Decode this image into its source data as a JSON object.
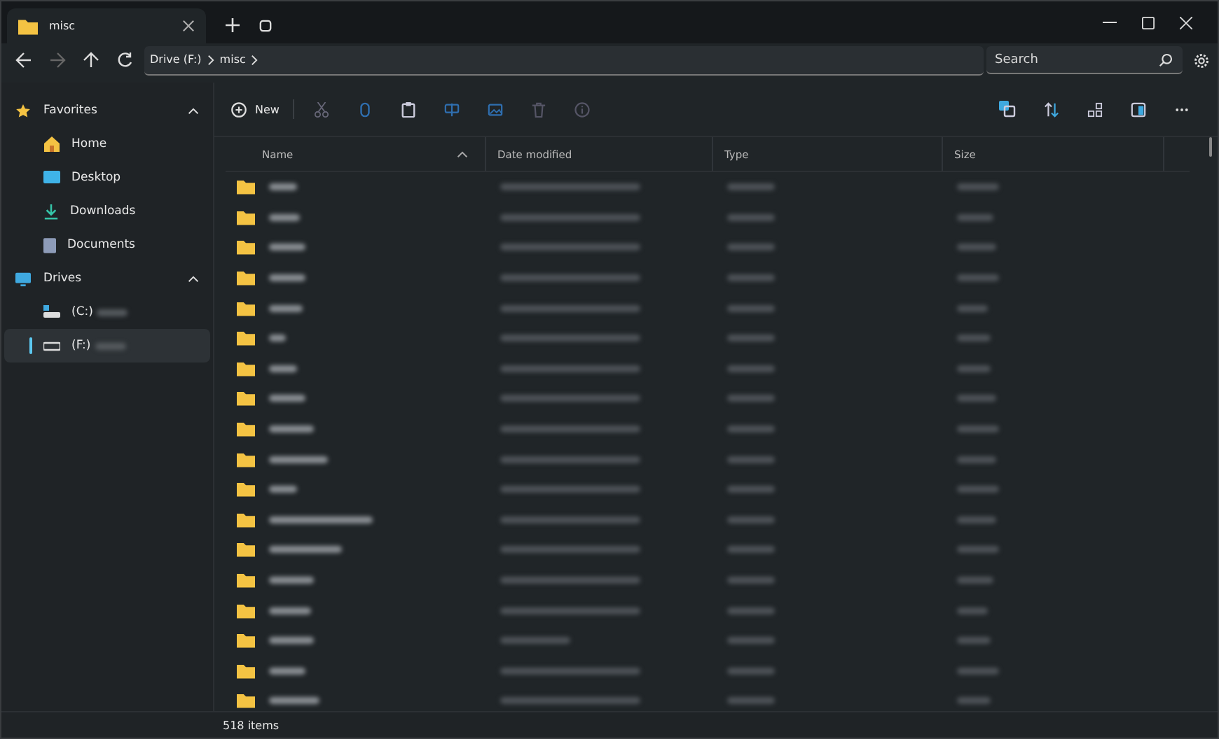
{
  "tab": {
    "title": "misc",
    "selected": true
  },
  "breadcrumb": [
    "Drive (F:)",
    "misc"
  ],
  "search": {
    "placeholder": "Search"
  },
  "sidebar": {
    "sections": [
      {
        "label": "Favorites",
        "kind": "favorites",
        "expanded": true,
        "items": [
          {
            "label": "Home",
            "kind": "home",
            "selected": false
          },
          {
            "label": "Desktop",
            "kind": "desktop",
            "selected": false
          },
          {
            "label": "Downloads",
            "kind": "downloads",
            "selected": false
          },
          {
            "label": "Documents",
            "kind": "documents",
            "selected": false
          }
        ]
      },
      {
        "label": "Drives",
        "kind": "drives",
        "expanded": true,
        "items": [
          {
            "label": "(C:)",
            "kind": "system-drive",
            "selected": false
          },
          {
            "label": "(F:)",
            "kind": "drive",
            "selected": true
          }
        ]
      }
    ]
  },
  "toolbar": {
    "new_label": "New"
  },
  "table": {
    "columns": [
      "Name",
      "Date modified",
      "Type",
      "Size"
    ],
    "rows": [
      {
        "kind": "folder"
      },
      {
        "kind": "folder"
      },
      {
        "kind": "folder"
      },
      {
        "kind": "folder"
      },
      {
        "kind": "folder"
      },
      {
        "kind": "folder"
      },
      {
        "kind": "folder"
      },
      {
        "kind": "folder"
      },
      {
        "kind": "folder"
      },
      {
        "kind": "folder"
      },
      {
        "kind": "folder"
      },
      {
        "kind": "folder"
      },
      {
        "kind": "folder"
      },
      {
        "kind": "folder"
      },
      {
        "kind": "folder"
      },
      {
        "kind": "folder"
      },
      {
        "kind": "folder"
      },
      {
        "kind": "folder"
      }
    ]
  },
  "status_bar": "518 items"
}
